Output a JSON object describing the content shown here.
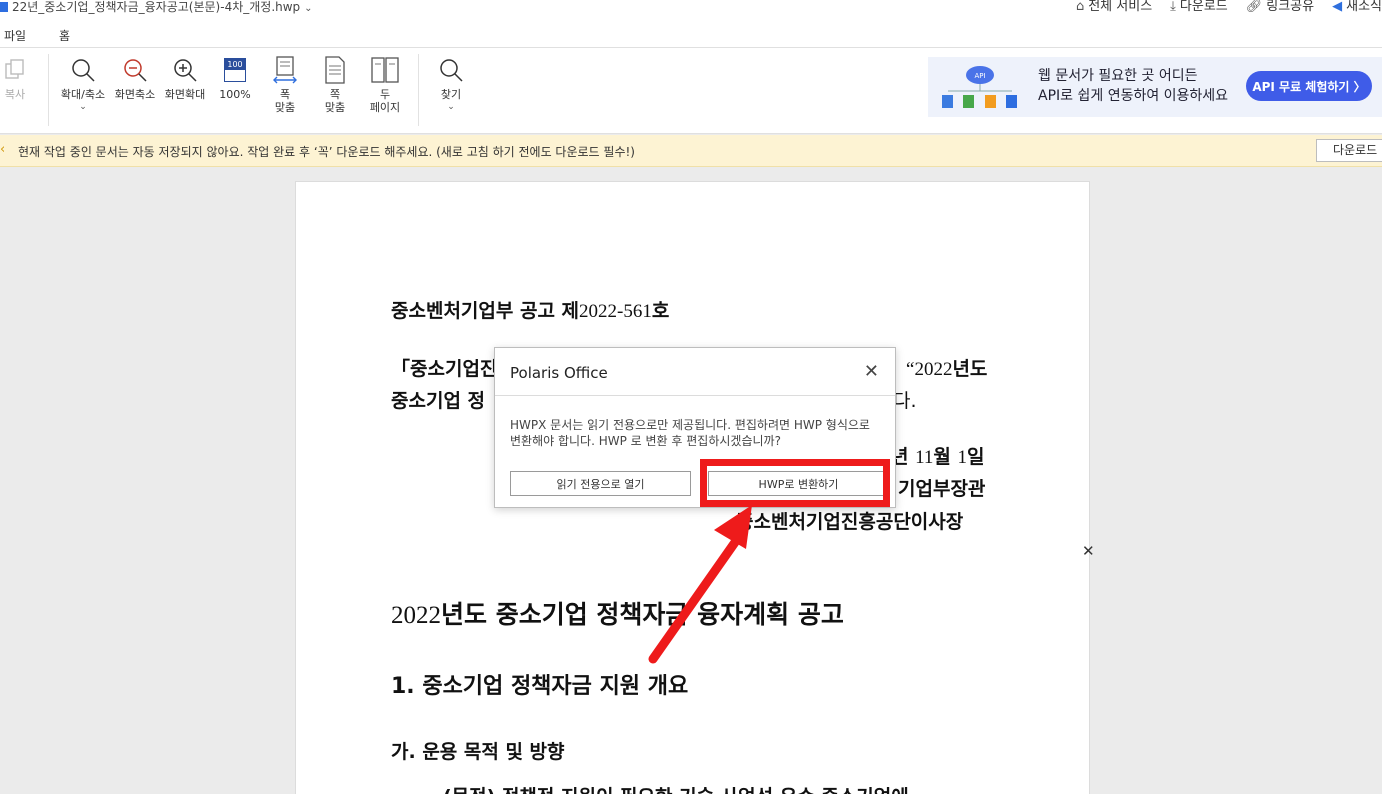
{
  "titlebar": {
    "doc_title": "22년_중소기업_정책자금_융자공고(본문)-4차_개정.hwp",
    "actions": [
      {
        "label": "전체 서비스",
        "icon": "home-icon"
      },
      {
        "label": "다운로드",
        "icon": "download-icon"
      },
      {
        "label": "링크공유",
        "icon": "link-icon"
      },
      {
        "label": "새소식",
        "icon": "megaphone-icon"
      }
    ]
  },
  "menu": {
    "file": "파일",
    "home": "홈"
  },
  "ribbon": {
    "copy": "복사",
    "zoom": "확대/축소",
    "zoom_out": "화면축소",
    "zoom_in": "화면확대",
    "percent_label": "100%",
    "percent_icon_text": "100",
    "fit_width_1": "폭",
    "fit_width_2": "맞춤",
    "fit_page_1": "쪽",
    "fit_page_2": "맞춤",
    "two_page_1": "두",
    "two_page_2": "페이지",
    "find": "찾기"
  },
  "ad": {
    "line1": "웹 문서가 필요한 곳 어디든",
    "line2": "API로 쉽게 연동하여 이용하세요",
    "cta": "API 무료 체험하기 〉",
    "badge": "API"
  },
  "notice": {
    "message": "현재 작업 중인 문서는 자동 저장되지 않아요. 작업 완료 후 ‘꼭’ 다운로드 해주세요. (새로 고침 하기 전에도 다운로드 필수!)",
    "download": "다운로드"
  },
  "document": {
    "notice_prefix": "중소벤처기업부 공고 제",
    "notice_num": "2022-561",
    "notice_suffix": "호",
    "p1_left": "「중소기업진",
    "p1_quote": "“",
    "p1_year": "2022",
    "p1_right": "년도",
    "p2_left": "중소기업 정",
    "p2_right": "다.",
    "date_year_suffix": "년",
    "date_month": "11",
    "date_month_label": "월",
    "date_day": "1",
    "date_day_label": "일",
    "sign1": "기업부장관",
    "sign2": "중소벤처기업진흥공단이사장",
    "heading_year": "2022",
    "heading_text": "년도 중소기업 정책자금 융자계획 공고",
    "section1": "1. 중소기업 정책자금 지원 개요",
    "section_ga": "가. 운용 목적 및 방향",
    "body_cut": "(목적) 정책적 지원이 필요한 기술 사업성 우수 중소기업에"
  },
  "dialog": {
    "title": "Polaris Office",
    "message": "HWPX 문서는 읽기 전용으로만 제공됩니다. 편집하려면 HWP 형식으로 변환해야 합니다. HWP 로 변환 후 편집하시겠습니까?",
    "read_only_button": "읽기 전용으로 열기",
    "convert_button": "HWP로 변환하기"
  },
  "colors": {
    "accent": "#2f6fdd",
    "cta": "#3f5ce8",
    "highlight": "#ee1b1b",
    "notice_bg": "#fdf3d3"
  }
}
